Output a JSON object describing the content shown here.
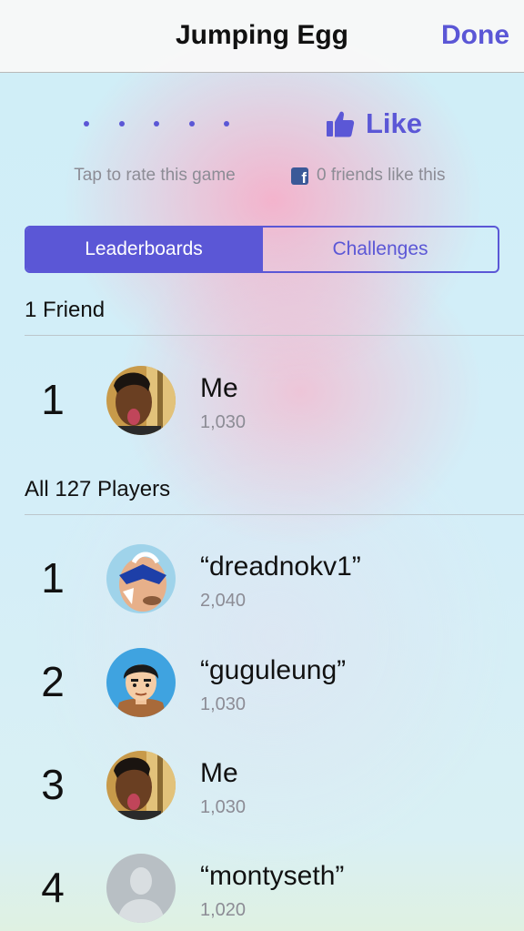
{
  "nav": {
    "title": "Jumping Egg",
    "done_label": "Done"
  },
  "rating": {
    "label": "Tap to rate this game",
    "dot_count": 5
  },
  "like": {
    "label": "Like",
    "friends_text": "0 friends like this",
    "fb_glyph": "f"
  },
  "tabs": [
    {
      "label": "Leaderboards",
      "active": true
    },
    {
      "label": "Challenges",
      "active": false
    }
  ],
  "friends_section": {
    "header": "1 Friend",
    "rows": [
      {
        "rank": "1",
        "name": "Me",
        "score": "1,030",
        "avatar": "photo-avatar"
      }
    ]
  },
  "all_section": {
    "header": "All 127 Players",
    "rows": [
      {
        "rank": "1",
        "name": "“dreadnokv1”",
        "score": "2,040",
        "avatar": "painted-face-avatar"
      },
      {
        "rank": "2",
        "name": "“guguleung”",
        "score": "1,030",
        "avatar": "cartoon-avatar"
      },
      {
        "rank": "3",
        "name": "Me",
        "score": "1,030",
        "avatar": "photo-avatar"
      },
      {
        "rank": "4",
        "name": "“montyseth”",
        "score": "1,020",
        "avatar": "default-silhouette-avatar"
      }
    ]
  },
  "colors": {
    "accent": "#5b57d6",
    "secondary_text": "#8c8c95",
    "facebook": "#3b5998"
  }
}
